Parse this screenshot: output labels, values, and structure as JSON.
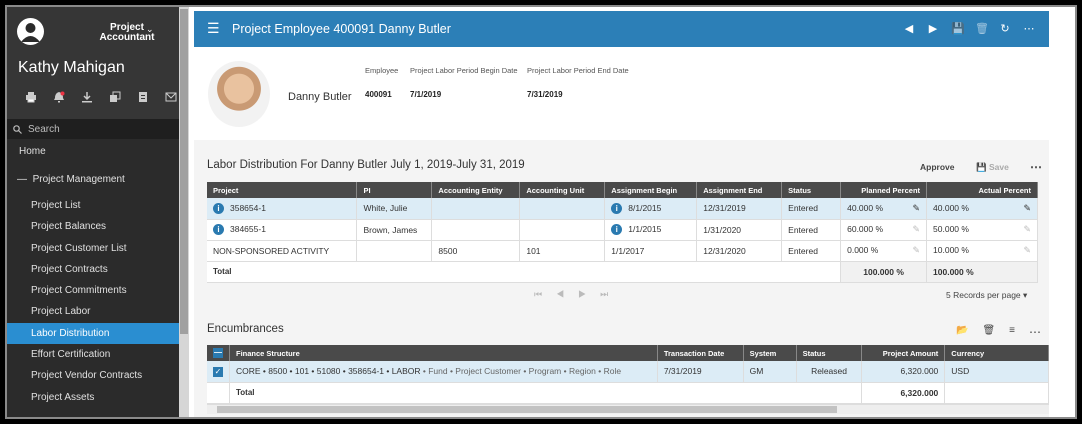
{
  "user": {
    "role": "Project Accountant",
    "name": "Kathy Mahigan"
  },
  "sidebar": {
    "search_placeholder": "Search",
    "home": "Home",
    "group": "Project Management",
    "items": [
      "Project List",
      "Project Balances",
      "Project Customer List",
      "Project Contracts",
      "Project Commitments",
      "Project Labor",
      "Labor Distribution",
      "Effort Certification",
      "Project Vendor Contracts",
      "Project Assets"
    ],
    "active_index": 6
  },
  "appbar": {
    "title": "Project Employee 400091 Danny Butler"
  },
  "employee": {
    "name": "Danny Butler",
    "fields": [
      {
        "label": "Employee",
        "value": "400091"
      },
      {
        "label": "Project Labor Period Begin Date",
        "value": "7/1/2019"
      },
      {
        "label": "Project Labor Period End Date",
        "value": "7/31/2019"
      }
    ]
  },
  "labor": {
    "title": "Labor Distribution For Danny Butler July 1, 2019-July 31, 2019",
    "approve": "Approve",
    "save": "Save",
    "columns": [
      "Project",
      "PI",
      "Accounting Entity",
      "Accounting Unit",
      "Assignment Begin",
      "Assignment End",
      "Status",
      "Planned Percent",
      "Actual Percent"
    ],
    "rows": [
      {
        "project": "358654-1",
        "pi": "White, Julie",
        "entity": "",
        "unit": "",
        "begin": "8/1/2015",
        "end": "12/31/2019",
        "status": "Entered",
        "planned": "40.000 %",
        "actual": "40.000 %"
      },
      {
        "project": "384655-1",
        "pi": "Brown, James",
        "entity": "",
        "unit": "",
        "begin": "1/1/2015",
        "end": "1/31/2020",
        "status": "Entered",
        "planned": "60.000 %",
        "actual": "50.000 %"
      },
      {
        "project": "NON-SPONSORED ACTIVITY",
        "pi": "",
        "entity": "8500",
        "unit": "101",
        "begin": "1/1/2017",
        "end": "12/31/2020",
        "status": "Entered",
        "planned": "0.000 %",
        "actual": "10.000 %"
      }
    ],
    "total_label": "Total",
    "total_planned": "100.000 %",
    "total_actual": "100.000 %",
    "records_per_page": "5 Records per page"
  },
  "encumbrances": {
    "title": "Encumbrances",
    "columns": [
      "Finance Structure",
      "Transaction Date",
      "System",
      "Status",
      "Project Amount",
      "Currency"
    ],
    "rows": [
      {
        "structure_main": "CORE • 8500 • 101 • 51080 • 358654-1 • LABOR",
        "structure_rest": " • Fund • Project Customer • Program • Region • Role",
        "date": "7/31/2019",
        "system": "GM",
        "status": "Released",
        "amount": "6,320.000",
        "currency": "USD"
      }
    ],
    "total_label": "Total",
    "total_amount": "6,320.000"
  }
}
